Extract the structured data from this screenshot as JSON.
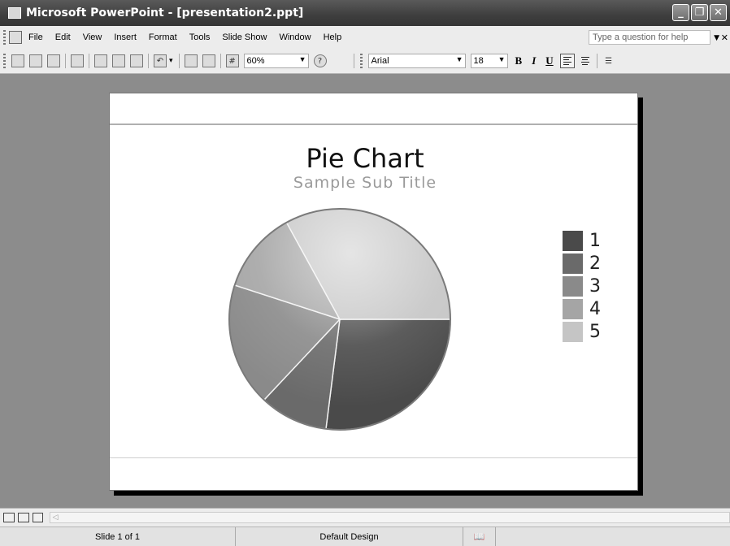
{
  "window": {
    "title": "Microsoft PowerPoint - [presentation2.ppt]"
  },
  "menu": {
    "items": [
      "File",
      "Edit",
      "View",
      "Insert",
      "Format",
      "Tools",
      "Slide Show",
      "Window",
      "Help"
    ],
    "help_placeholder": "Type a question for help"
  },
  "toolbar": {
    "zoom": "60%",
    "font": "Arial",
    "font_size": "18",
    "bold_label": "B",
    "italic_label": "I",
    "underline_label": "U"
  },
  "slide": {
    "title": "Pie Chart",
    "subtitle": "Sample Sub Title"
  },
  "chart_data": {
    "type": "pie",
    "categories": [
      "1",
      "2",
      "3",
      "4",
      "5"
    ],
    "values": [
      27,
      10,
      18,
      12,
      33
    ],
    "colors": [
      "#4a4a4a",
      "#6a6a6a",
      "#8a8a8a",
      "#a5a5a5",
      "#c5c5c5"
    ]
  },
  "status": {
    "slide": "Slide 1 of 1",
    "design": "Default Design"
  }
}
